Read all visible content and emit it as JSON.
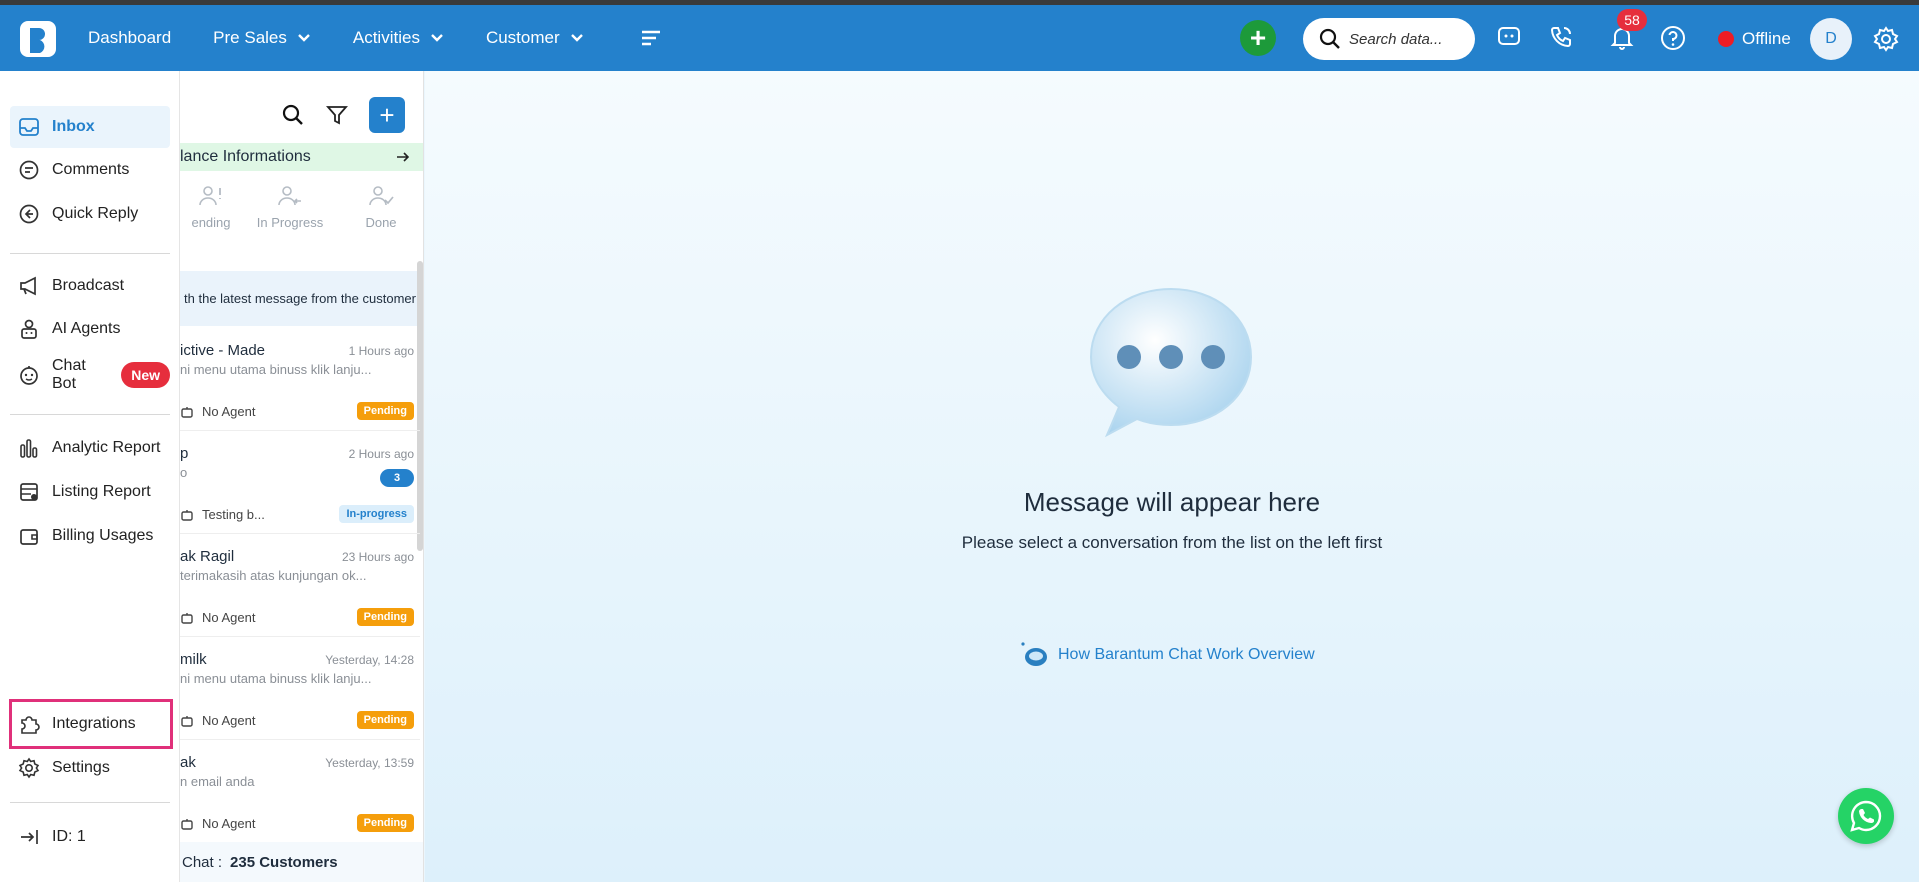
{
  "topbar": {
    "nav": [
      {
        "label": "Dashboard"
      },
      {
        "label": "Pre Sales"
      },
      {
        "label": "Activities"
      },
      {
        "label": "Customer"
      }
    ],
    "search_placeholder": "Search data...",
    "notification_count": "58",
    "status": "Offline",
    "avatar_initial": "D",
    "colors": {
      "bar": "#2481cc",
      "add": "#1d9a3a",
      "offline": "#ee1c25"
    }
  },
  "sidebar": {
    "items": [
      {
        "label": "Inbox",
        "icon": "inbox-icon"
      },
      {
        "label": "Comments",
        "icon": "comment-icon"
      },
      {
        "label": "Quick Reply",
        "icon": "reply-icon"
      },
      {
        "label": "Broadcast",
        "icon": "megaphone-icon"
      },
      {
        "label": "AI Agents",
        "icon": "robot-icon"
      },
      {
        "label": "Chat Bot",
        "icon": "bot-icon",
        "badge": "New"
      },
      {
        "label": "Analytic Report",
        "icon": "bar-chart-icon"
      },
      {
        "label": "Listing Report",
        "icon": "report-icon"
      },
      {
        "label": "Billing Usages",
        "icon": "wallet-icon"
      },
      {
        "label": "Integrations",
        "icon": "puzzle-icon"
      },
      {
        "label": "Settings",
        "icon": "gear-icon"
      },
      {
        "label": "ID: 1",
        "icon": "arrow-in-icon"
      }
    ]
  },
  "list": {
    "balance_text": "lance Informations",
    "tabs": [
      {
        "label": "ending"
      },
      {
        "label": "In Progress"
      },
      {
        "label": "Done"
      }
    ],
    "info_text": "th the latest message from the customer",
    "conversations": [
      {
        "name": "ictive - Made",
        "time": "1 Hours ago",
        "snippet": "ni menu utama binuss klik lanju...",
        "agent": "No Agent",
        "status": "Pending"
      },
      {
        "name": "p",
        "time": "2 Hours ago",
        "snippet": "o",
        "agent": "Testing b...",
        "status": "In-progress",
        "unread": "3"
      },
      {
        "name": "ak Ragil",
        "time": "23 Hours ago",
        "snippet": "terimakasih atas kunjungan ok...",
        "agent": "No Agent",
        "status": "Pending"
      },
      {
        "name": "milk",
        "time": "Yesterday, 14:28",
        "snippet": "ni menu utama binuss klik lanju...",
        "agent": "No Agent",
        "status": "Pending"
      },
      {
        "name": "ak",
        "time": "Yesterday, 13:59",
        "snippet": "n email anda",
        "agent": "No Agent",
        "status": "Pending"
      }
    ],
    "footer_label": "Chat :",
    "footer_value": "235 Customers"
  },
  "main": {
    "title": "Message will appear here",
    "subtitle": "Please select a conversation from the list on the left first",
    "link": "How Barantum Chat Work Overview"
  }
}
